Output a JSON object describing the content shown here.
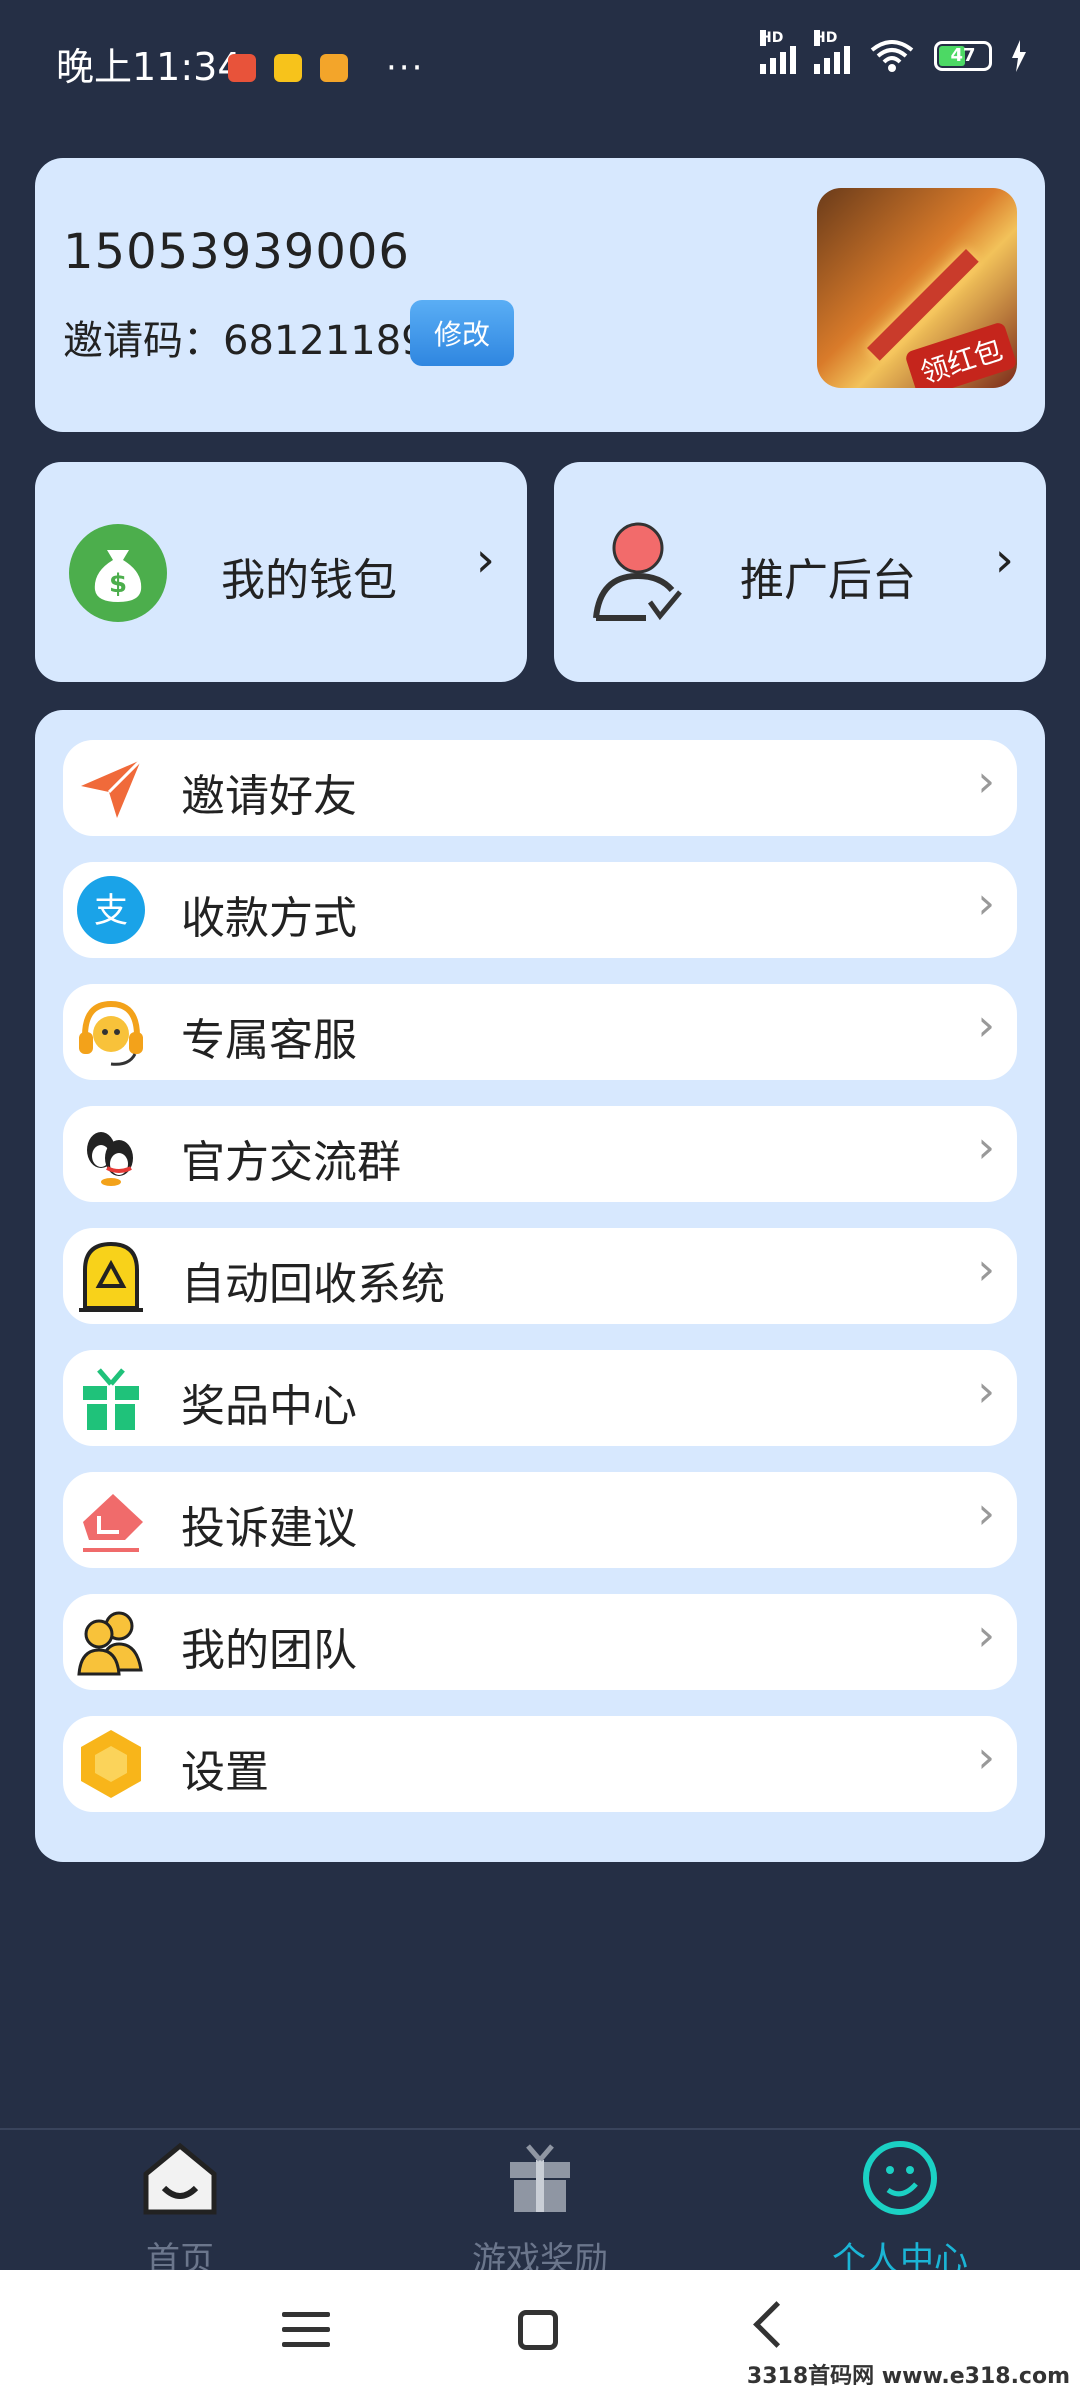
{
  "status_bar": {
    "time": "晚上11:34",
    "signal_1_label": "HD",
    "signal_2_label": "HD",
    "battery": "47"
  },
  "profile": {
    "phone": "15053939006",
    "invite_label": "邀请码：",
    "invite_code": "68121189",
    "edit_button": "修改",
    "avatar_tag": "领红包"
  },
  "quick": {
    "wallet": "我的钱包",
    "promo": "推广后台"
  },
  "menu": [
    {
      "label": "邀请好友",
      "icon": "paper-plane-icon"
    },
    {
      "label": "收款方式",
      "icon": "alipay-icon"
    },
    {
      "label": "专属客服",
      "icon": "headset-icon"
    },
    {
      "label": "官方交流群",
      "icon": "qq-group-icon"
    },
    {
      "label": "自动回收系统",
      "icon": "recycle-icon"
    },
    {
      "label": "奖品中心",
      "icon": "gift-icon"
    },
    {
      "label": "投诉建议",
      "icon": "complaint-icon"
    },
    {
      "label": "我的团队",
      "icon": "team-icon"
    },
    {
      "label": "设置",
      "icon": "settings-hex-icon"
    }
  ],
  "tabs": {
    "home": "首页",
    "rewards": "游戏奖励",
    "profile": "个人中心"
  },
  "watermark": "3318首码网 www.e318.com",
  "colors": {
    "background": "#252f45",
    "card": "#d7e8fe",
    "accent": "#1bb5d6"
  }
}
